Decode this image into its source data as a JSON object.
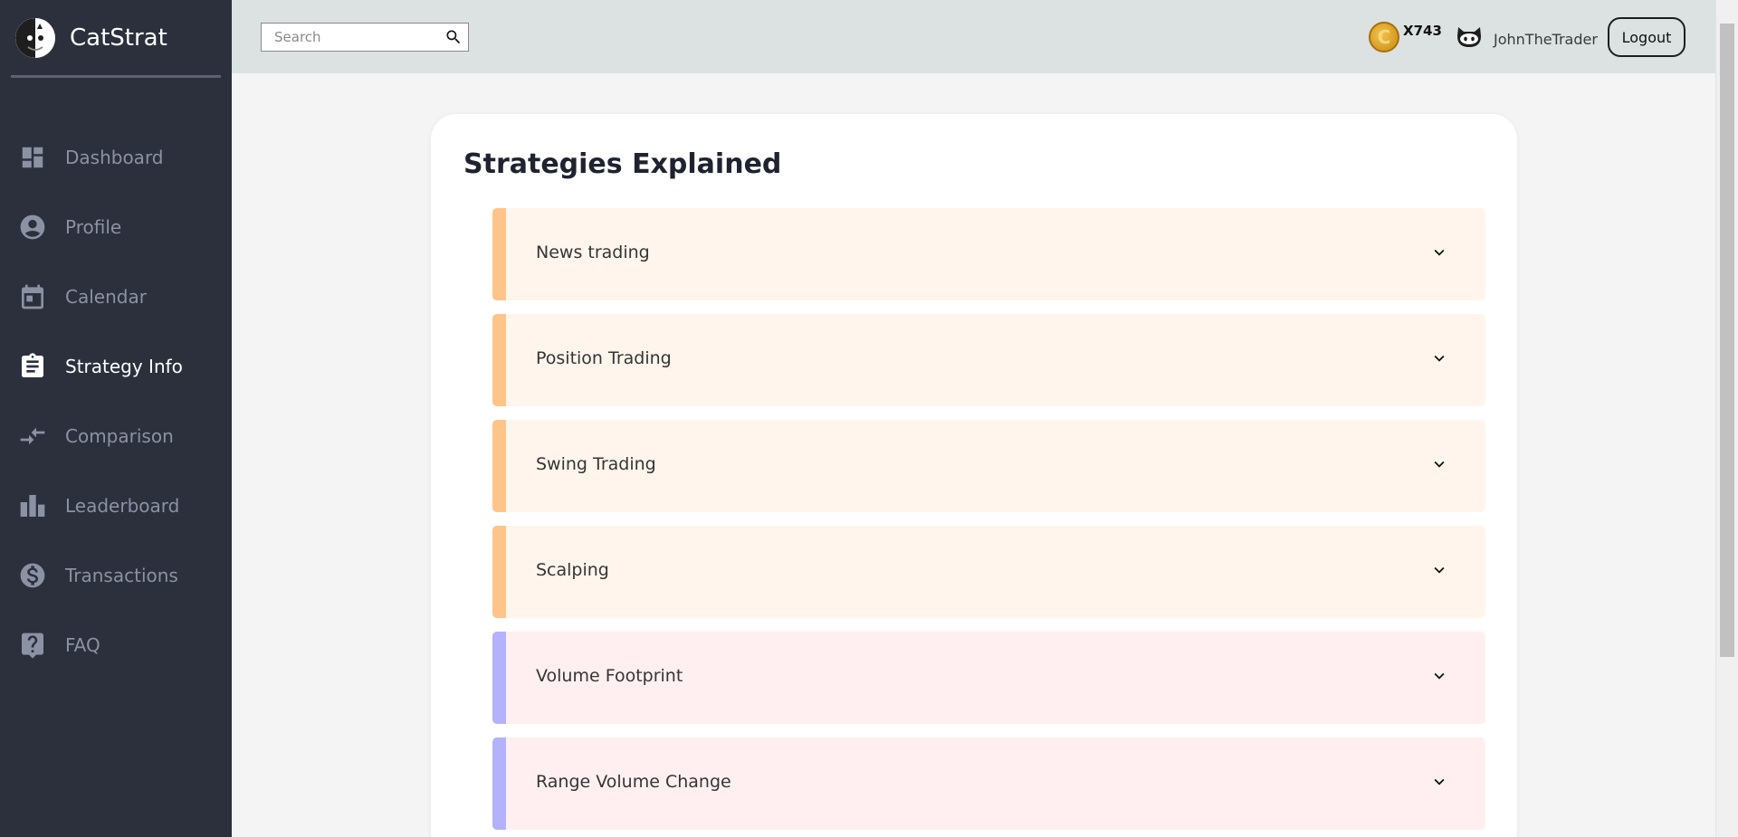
{
  "brand": {
    "name": "CatStrat"
  },
  "sidebar": {
    "items": [
      {
        "label": "Dashboard",
        "icon": "dashboard-icon",
        "active": false
      },
      {
        "label": "Profile",
        "icon": "account-circle-icon",
        "active": false
      },
      {
        "label": "Calendar",
        "icon": "calendar-icon",
        "active": false
      },
      {
        "label": "Strategy Info",
        "icon": "clipboard-icon",
        "active": true
      },
      {
        "label": "Comparison",
        "icon": "compare-arrows-icon",
        "active": false
      },
      {
        "label": "Leaderboard",
        "icon": "leaderboard-icon",
        "active": false
      },
      {
        "label": "Transactions",
        "icon": "dollar-circle-icon",
        "active": false
      },
      {
        "label": "FAQ",
        "icon": "question-icon",
        "active": false
      }
    ]
  },
  "topbar": {
    "search_placeholder": "Search",
    "coin_count": "X743",
    "username": "JohnTheTrader",
    "logout_label": "Logout"
  },
  "main": {
    "title": "Strategies Explained",
    "strategies": [
      {
        "label": "News trading",
        "group": "orange"
      },
      {
        "label": "Position Trading",
        "group": "orange"
      },
      {
        "label": "Swing Trading",
        "group": "orange"
      },
      {
        "label": "Scalping",
        "group": "orange"
      },
      {
        "label": "Volume Footprint",
        "group": "purple"
      },
      {
        "label": "Range Volume Change",
        "group": "purple"
      }
    ]
  },
  "colors": {
    "sidebar_bg": "#2b303c",
    "orange_bar": "#ffc48a",
    "orange_bg": "#fff5ec",
    "purple_bar": "#b3b2fb",
    "purple_bg": "#ffeff1"
  }
}
